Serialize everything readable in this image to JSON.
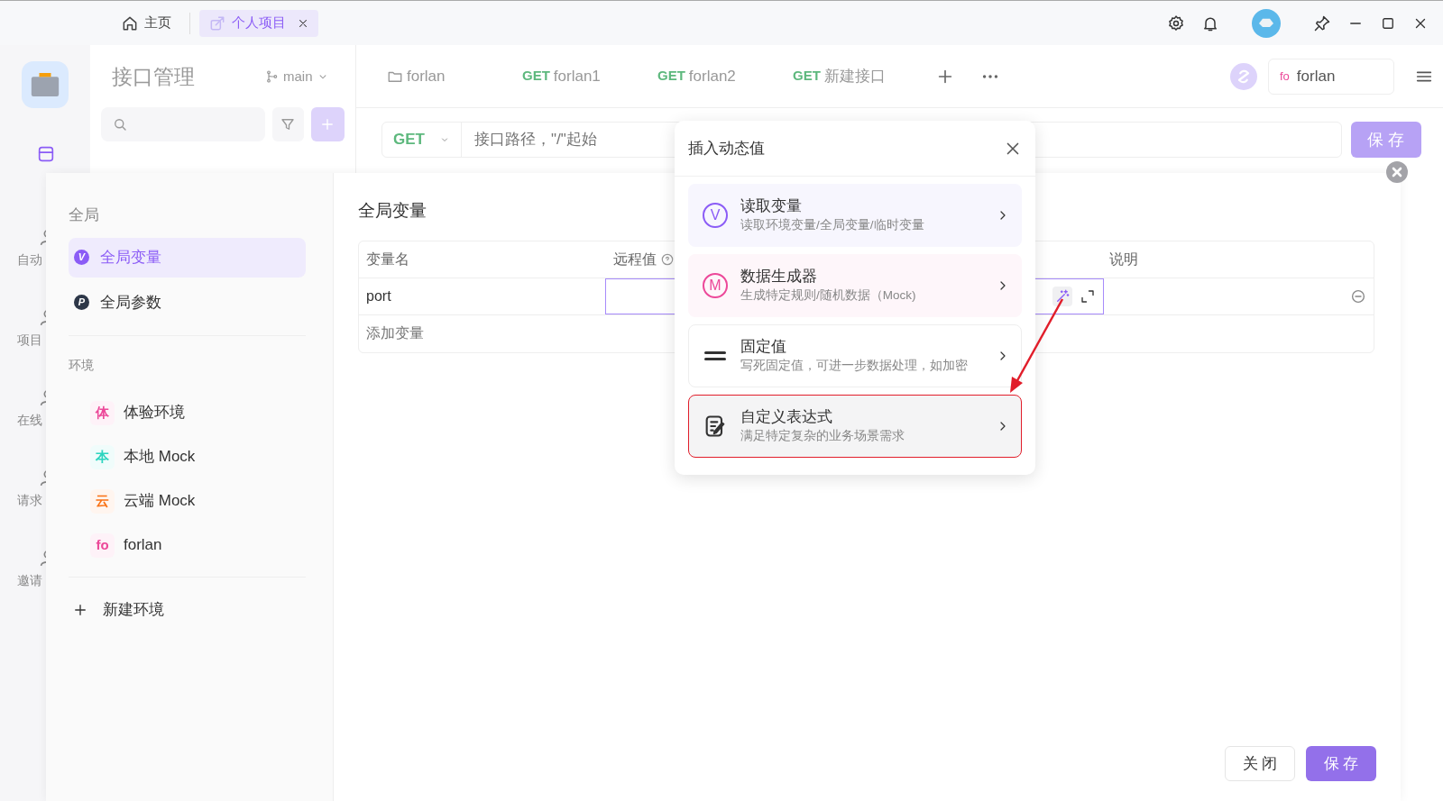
{
  "titlebar": {
    "tabs": [
      {
        "label": "主页",
        "selected": false,
        "closable": false
      },
      {
        "label": "个人项目",
        "selected": true,
        "closable": true
      }
    ]
  },
  "background": {
    "rail": [
      "自动",
      "项目",
      "在线",
      "请求",
      "邀请"
    ],
    "module_title": "接口管理",
    "branch": "main",
    "tabs": [
      {
        "kind": "folder",
        "label": "forlan"
      },
      {
        "kind": "request",
        "method": "GET",
        "label": "forlan1"
      },
      {
        "kind": "request",
        "method": "GET",
        "label": "forlan2"
      },
      {
        "kind": "request",
        "method": "GET",
        "label": "新建接口"
      }
    ],
    "environment": {
      "badge": "fo",
      "name": "forlan"
    },
    "method": "GET",
    "url_placeholder": "接口路径，\"/\"起始",
    "save": "保 存"
  },
  "modal": {
    "global_heading": "全局",
    "global_items": [
      {
        "letter": "V",
        "label": "全局变量",
        "selected": true
      },
      {
        "letter": "P",
        "label": "全局参数",
        "selected": false
      }
    ],
    "env_heading": "环境",
    "environments": [
      {
        "badge": "体",
        "name": "体验环境",
        "color": "#ec4899"
      },
      {
        "badge": "本",
        "name": "本地 Mock",
        "color": "#2dd4bf"
      },
      {
        "badge": "云",
        "name": "云端 Mock",
        "color": "#f97316"
      },
      {
        "badge": "fo",
        "name": "forlan",
        "color": "#ec4899"
      }
    ],
    "new_env": "新建环境",
    "title": "全局变量",
    "table": {
      "columns": [
        "变量名",
        "远程值",
        "说明"
      ],
      "rows": [
        {
          "name": "port"
        }
      ],
      "add_placeholder": "添加变量"
    },
    "buttons": [
      {
        "label": "关 闭",
        "kind": "secondary"
      },
      {
        "label": "保 存",
        "kind": "primary"
      }
    ]
  },
  "popup": {
    "title": "插入动态值",
    "options": [
      {
        "kind": "variable",
        "letter": "V",
        "title": "读取变量",
        "description": "读取环境变量/全局变量/临时变量",
        "selected": false
      },
      {
        "kind": "mock",
        "letter": "M",
        "title": "数据生成器",
        "description": "生成特定规则/随机数据（Mock)",
        "selected": false
      },
      {
        "kind": "fixed",
        "title": "固定值",
        "description": "写死固定值，可进一步数据处理，如加密",
        "selected": false
      },
      {
        "kind": "expression",
        "title": "自定义表达式",
        "description": "满足特定复杂的业务场景需求",
        "selected": true
      }
    ]
  }
}
